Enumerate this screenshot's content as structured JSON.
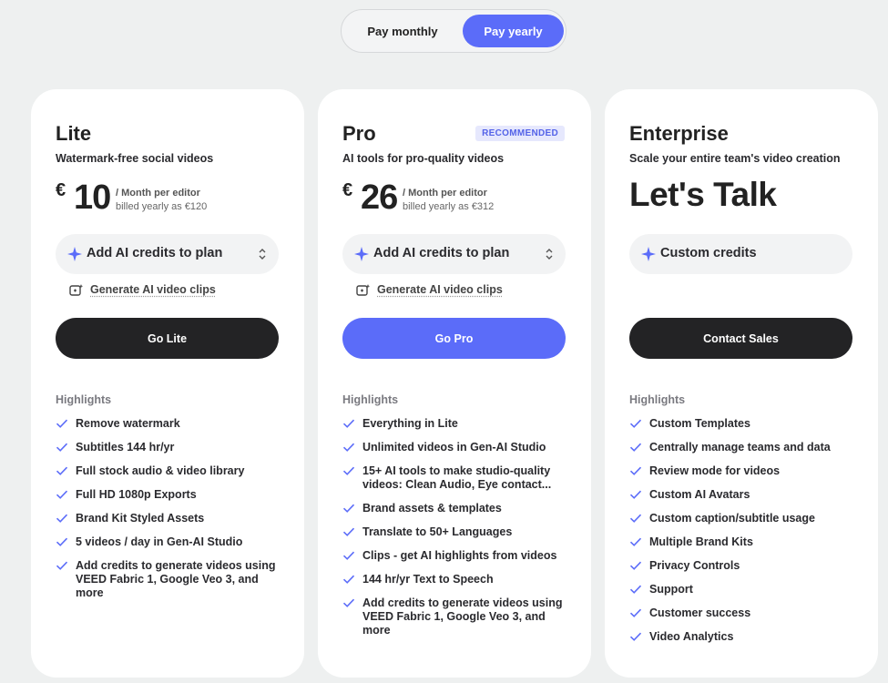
{
  "billing_toggle": {
    "monthly": "Pay monthly",
    "yearly": "Pay yearly",
    "selected": "yearly"
  },
  "colors": {
    "accent": "#5b6cf9",
    "dark_button": "#232325",
    "badge_bg": "#e6e8fd"
  },
  "plans": [
    {
      "name": "Lite",
      "tagline": "Watermark-free social videos",
      "currency": "€",
      "amount": "10",
      "per": "/ Month per editor",
      "billed": "billed yearly as €120",
      "credits_label": "Add AI credits to plan",
      "generate_label": "Generate AI video clips",
      "cta": "Go Lite",
      "highlights_title": "Highlights",
      "features": [
        "Remove watermark",
        "Subtitles 144 hr/yr",
        "Full stock audio & video library",
        "Full HD 1080p Exports",
        "Brand Kit Styled Assets",
        "5 videos / day in Gen-AI Studio",
        "Add credits to generate videos using VEED Fabric 1, Google Veo 3, and more"
      ]
    },
    {
      "name": "Pro",
      "badge": "RECOMMENDED",
      "tagline": "AI tools for pro-quality videos",
      "currency": "€",
      "amount": "26",
      "per": "/ Month per editor",
      "billed": "billed yearly as €312",
      "credits_label": "Add AI credits to plan",
      "generate_label": "Generate AI video clips",
      "cta": "Go Pro",
      "highlights_title": "Highlights",
      "features": [
        "Everything in Lite",
        "Unlimited videos in Gen-AI Studio",
        "15+ AI tools to make studio-quality videos: Clean Audio, Eye contact...",
        "Brand assets & templates",
        "Translate to 50+ Languages",
        "Clips - get AI highlights from videos",
        "144 hr/yr Text to Speech",
        "Add credits to generate videos using VEED Fabric 1, Google Veo 3, and more"
      ]
    },
    {
      "name": "Enterprise",
      "tagline": "Scale your entire team's video creation",
      "headline": "Let's Talk",
      "credits_label": "Custom credits",
      "cta": "Contact Sales",
      "highlights_title": "Highlights",
      "features": [
        "Custom Templates",
        "Centrally manage teams and data",
        "Review mode for videos",
        "Custom AI Avatars",
        "Custom caption/subtitle usage",
        "Multiple Brand Kits",
        "Privacy Controls",
        "Support",
        "Customer success",
        "Video Analytics"
      ]
    }
  ]
}
